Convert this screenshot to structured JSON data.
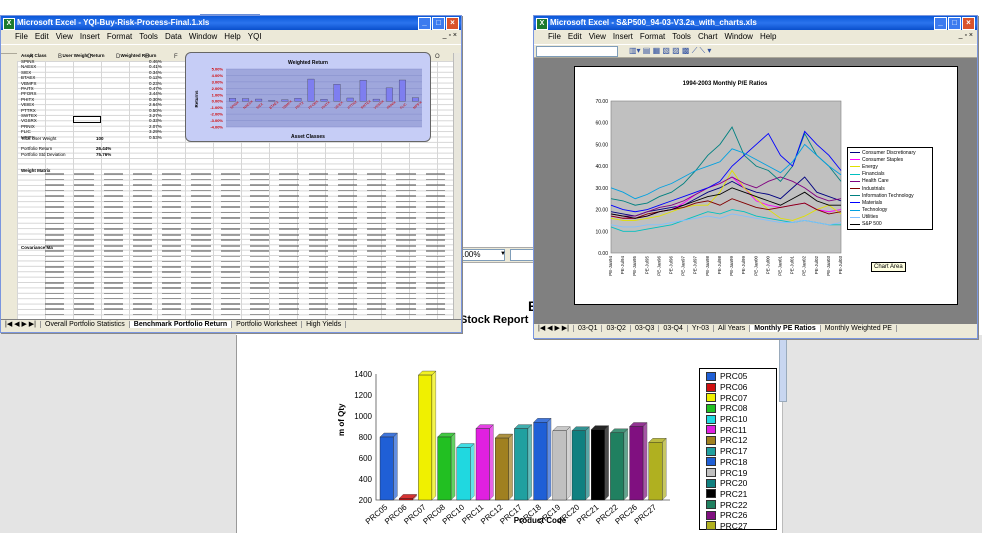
{
  "background_report": {
    "stock_report_text": "Stock Report",
    "e_char": "E",
    "zoom_value": "100%",
    "chart": {
      "ylabel": "m of Qty",
      "xlabel": "Product Code",
      "legend": [
        "PRC05",
        "PRC06",
        "PRC07",
        "PRC08",
        "PRC10",
        "PRC11",
        "PRC12",
        "PRC17",
        "PRC18",
        "PRC19",
        "PRC20",
        "PRC21",
        "PRC22",
        "PRC26",
        "PRC27"
      ]
    }
  },
  "left_window": {
    "title": "Microsoft Excel - YQI-Buy-Risk-Process-Final.1.xls",
    "menu": [
      "File",
      "Edit",
      "View",
      "Insert",
      "Format",
      "Tools",
      "Data",
      "Window",
      "Help",
      "YQI"
    ],
    "columns": [
      "A",
      "B",
      "C",
      "D",
      "E",
      "F",
      "G",
      "H",
      "I",
      "J",
      "K",
      "L",
      "M",
      "N",
      "O"
    ],
    "asset_header": [
      "Asset Class",
      "User Weight Return",
      "Weighted Return"
    ],
    "assets": [
      "SPINX",
      "NAESX",
      "SIEX",
      "BTAEX",
      "VBMFX",
      "PAITX",
      "PFORX",
      "PHITX",
      "VEIEX",
      "PTTRX",
      "SWTEX",
      "VGSRX",
      "PRNIX",
      "FLIC",
      "MPIFX"
    ],
    "asset_returns": [
      "0.46%",
      "0.41%",
      "0.34%",
      "0.12%",
      "0.23%",
      "0.47%",
      "3.44%",
      "0.30%",
      "2.64%",
      "0.50%",
      "3.27%",
      "0.33%",
      "2.07%",
      "3.29%",
      "0.53%"
    ],
    "summary_labels": [
      "Total User Weight",
      "Portfolio Return",
      "Portfolio Std Deviation"
    ],
    "summary_values": [
      "100",
      "26.44%",
      "75.76%"
    ],
    "weight_matrix_label": "Weight Matrix",
    "covariance_label": "Covariance Ma",
    "tabs": [
      "Overall Portfolio Statistics",
      "Benchmark Portfolio Return",
      "Portfolio Worksheet",
      "High Yields"
    ],
    "inner_chart": {
      "title": "Weighted Return",
      "ylabel": "Returns",
      "xlabel": "Asset Classes",
      "yticks": [
        "5.00%",
        "4.00%",
        "3.00%",
        "2.00%",
        "1.00%",
        "0.00%",
        "-1.00%",
        "-2.00%",
        "-3.00%",
        "-4.00%"
      ]
    }
  },
  "right_window": {
    "title": "Microsoft Excel - S&P500_94-03-V3.2a_with_charts.xls",
    "menu": [
      "File",
      "Edit",
      "View",
      "Insert",
      "Format",
      "Tools",
      "Chart",
      "Window",
      "Help"
    ],
    "tabs": [
      "03-Q1",
      "03-Q2",
      "03-Q3",
      "03-Q4",
      "Yr-03",
      "All Years",
      "Monthly PE Ratios",
      "Monthly Weighted PE"
    ],
    "chart_area_tooltip": "Chart Area",
    "pe_chart": {
      "title": "1994-2003 Monthly P/E Ratios",
      "yticks": [
        "70.00",
        "60.00",
        "50.00",
        "40.00",
        "30.00",
        "20.00",
        "10.00",
        "0.00"
      ],
      "legend": [
        "Consumer Discretionary",
        "Consumer Staples",
        "Energy",
        "Financials",
        "Health Care",
        "Industrials",
        "Information Technology",
        "Materials",
        "Technology",
        "Utilities",
        "S&P 500"
      ],
      "xticks": [
        "PE-Jan94",
        "PE-Jul94",
        "PE-Jan95",
        "PE-Jul95",
        "PE-Jan96",
        "PE-Jul96",
        "PE-Jan97",
        "PE-Jul97",
        "PE-Jan98",
        "PE-Jul98",
        "PE-Jan99",
        "PE-Jul99",
        "PE-Jan00",
        "PE-Jul00",
        "PE-Jan01",
        "PE-Jul01",
        "PE-Jan02",
        "PE-Jul02",
        "PE-Jan03",
        "PE-Jul03"
      ]
    }
  },
  "chart_data": [
    {
      "type": "bar",
      "title": "",
      "xlabel": "Product Code",
      "ylabel": "m of Qty",
      "ylim": [
        200,
        1400
      ],
      "yticks": [
        200,
        400,
        600,
        800,
        1000,
        1200,
        1400
      ],
      "categories": [
        "PRC05",
        "PRC06",
        "PRC07",
        "PRC08",
        "PRC10",
        "PRC11",
        "PRC12",
        "PRC17",
        "PRC18",
        "PRC19",
        "PRC20",
        "PRC21",
        "PRC22",
        "PRC26",
        "PRC27"
      ],
      "values": [
        800,
        215,
        1390,
        800,
        700,
        880,
        790,
        880,
        940,
        860,
        860,
        870,
        840,
        900,
        750
      ],
      "colors": [
        "#1f5fd6",
        "#d01010",
        "#f0f000",
        "#22c022",
        "#20d8e0",
        "#e020e0",
        "#a08020",
        "#20a0a0",
        "#1f5fd6",
        "#c0c0c0",
        "#108080",
        "#000000",
        "#208060",
        "#801080",
        "#b0b020"
      ],
      "legend_position": "right"
    },
    {
      "type": "bar",
      "title": "Weighted Return",
      "xlabel": "Asset Classes",
      "ylabel": "Returns",
      "ylim": [
        -4,
        5
      ],
      "categories": [
        "SPINX",
        "NAESX",
        "SIEX",
        "BTAEX",
        "VBMFX",
        "PAITX",
        "PFORX",
        "PHITX",
        "VEIEX",
        "PTTRX",
        "SWTEX",
        "VGSRX",
        "PRNIX",
        "FLIC",
        "MPIFX"
      ],
      "values": [
        0.46,
        0.41,
        0.34,
        0.12,
        0.23,
        0.47,
        3.44,
        0.3,
        2.64,
        0.5,
        3.27,
        0.33,
        2.07,
        3.29,
        0.53
      ]
    },
    {
      "type": "line",
      "title": "1994-2003 Monthly P/E Ratios",
      "ylim": [
        0,
        70
      ],
      "x": [
        "PE-Jan94",
        "PE-Jul94",
        "PE-Jan95",
        "PE-Jul95",
        "PE-Jan96",
        "PE-Jul96",
        "PE-Jan97",
        "PE-Jul97",
        "PE-Jan98",
        "PE-Jul98",
        "PE-Jan99",
        "PE-Jul99",
        "PE-Jan00",
        "PE-Jul00",
        "PE-Jan01",
        "PE-Jul01",
        "PE-Jan02",
        "PE-Jul02",
        "PE-Jan03",
        "PE-Jul03"
      ],
      "series": [
        {
          "name": "Consumer Discretionary",
          "color": "#000080",
          "values": [
            19,
            18,
            17,
            19,
            20,
            21,
            22,
            25,
            28,
            30,
            33,
            30,
            28,
            27,
            25,
            30,
            35,
            28,
            26,
            24
          ]
        },
        {
          "name": "Consumer Staples",
          "color": "#ff00ff",
          "values": [
            17,
            16,
            16,
            17,
            19,
            20,
            23,
            27,
            30,
            32,
            35,
            30,
            24,
            22,
            21,
            22,
            23,
            20,
            19,
            20
          ]
        },
        {
          "name": "Energy",
          "color": "#e0e000",
          "values": [
            16,
            15,
            15,
            16,
            17,
            19,
            21,
            22,
            22,
            28,
            38,
            30,
            25,
            20,
            16,
            15,
            17,
            20,
            22,
            18
          ]
        },
        {
          "name": "Financials",
          "color": "#00c0c0",
          "values": [
            12,
            10,
            10,
            11,
            12,
            13,
            15,
            17,
            19,
            18,
            20,
            19,
            17,
            16,
            15,
            14,
            15,
            14,
            13,
            13
          ]
        },
        {
          "name": "Health Care",
          "color": "#800080",
          "values": [
            18,
            17,
            17,
            19,
            21,
            22,
            24,
            27,
            30,
            32,
            35,
            32,
            30,
            33,
            35,
            33,
            30,
            26,
            24,
            25
          ]
        },
        {
          "name": "Industrials",
          "color": "#800000",
          "values": [
            17,
            16,
            16,
            18,
            19,
            20,
            21,
            23,
            24,
            22,
            25,
            23,
            21,
            20,
            21,
            22,
            23,
            20,
            18,
            19
          ]
        },
        {
          "name": "Information Technology",
          "color": "#008080",
          "values": [
            25,
            24,
            22,
            23,
            26,
            28,
            32,
            38,
            45,
            50,
            58,
            45,
            40,
            38,
            33,
            40,
            55,
            45,
            40,
            33
          ]
        },
        {
          "name": "Materials",
          "color": "#0000ff",
          "values": [
            22,
            20,
            19,
            20,
            22,
            24,
            26,
            28,
            30,
            33,
            40,
            45,
            50,
            55,
            45,
            40,
            56,
            50,
            45,
            38
          ]
        },
        {
          "name": "Technology",
          "color": "#00a0e0",
          "values": [
            30,
            28,
            25,
            27,
            30,
            32,
            35,
            38,
            40,
            42,
            48,
            46,
            43,
            40,
            37,
            42,
            50,
            45,
            40,
            36
          ]
        },
        {
          "name": "Utilities",
          "color": "#80c0ff",
          "values": [
            13,
            12,
            12,
            13,
            13,
            14,
            15,
            16,
            17,
            16,
            18,
            17,
            16,
            15,
            14,
            14,
            15,
            14,
            13,
            14
          ]
        },
        {
          "name": "S&P 500",
          "color": "#000000",
          "values": [
            18,
            17,
            16,
            17,
            19,
            20,
            22,
            24,
            26,
            27,
            30,
            28,
            26,
            24,
            22,
            25,
            28,
            24,
            22,
            22
          ]
        }
      ],
      "legend_position": "right"
    }
  ]
}
